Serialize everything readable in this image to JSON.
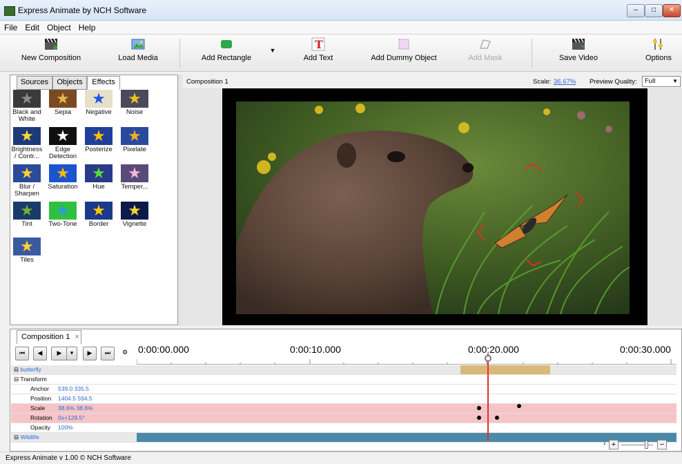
{
  "window": {
    "title": "Express Animate by NCH Software",
    "minimize": "–",
    "maximize": "□",
    "close": "✕"
  },
  "menu": [
    "File",
    "Edit",
    "Object",
    "Help"
  ],
  "toolbar": {
    "new_composition": "New Composition",
    "load_media": "Load Media",
    "add_rectangle": "Add Rectangle",
    "add_text": "Add Text",
    "add_dummy_object": "Add Dummy Object",
    "add_mask": "Add Mask",
    "save_video": "Save Video",
    "options": "Options"
  },
  "panel_tabs": [
    "Sources",
    "Objects",
    "Effects"
  ],
  "effects": [
    {
      "label": "Black and White",
      "star": "#8a8a8a",
      "bg": "#3a3a3a"
    },
    {
      "label": "Sepia",
      "star": "#e8b84a",
      "bg": "#7a4a22"
    },
    {
      "label": "Negative",
      "star": "#2056e8",
      "bg": "#e6e0c8"
    },
    {
      "label": "Noise",
      "star": "#f0c020",
      "bg": "#4a4a5a"
    },
    {
      "label": "Brightness / Contr...",
      "star": "#ffd830",
      "bg": "#1c3a7a"
    },
    {
      "label": "Edge Detection",
      "star": "#ffffff",
      "bg": "#101010"
    },
    {
      "label": "Posterize",
      "star": "#ffc000",
      "bg": "#1f3f9a"
    },
    {
      "label": "Pixelate",
      "star": "#f0b020",
      "bg": "#2a4aa0"
    },
    {
      "label": "Blur / Sharpen",
      "star": "#ffd030",
      "bg": "#2a4a9a"
    },
    {
      "label": "Saturation",
      "star": "#ffb800",
      "bg": "#1c54d0"
    },
    {
      "label": "Hue",
      "star": "#50e030",
      "bg": "#2a3a8a"
    },
    {
      "label": "Temper...",
      "star": "#f0b8e0",
      "bg": "#5a4a7a"
    },
    {
      "label": "Tint",
      "star": "#7ab030",
      "bg": "#1a3a6a"
    },
    {
      "label": "Two-Tone",
      "star": "#2a9ae0",
      "bg": "#30c040"
    },
    {
      "label": "Border",
      "star": "#ffc800",
      "bg": "#1c3a8a"
    },
    {
      "label": "Vignette",
      "star": "#ffd030",
      "bg": "#0c1a4a"
    },
    {
      "label": "Tiles",
      "star": "#ffd030",
      "bg": "#3a5aa0"
    }
  ],
  "preview": {
    "composition_label": "Composition 1",
    "scale_label": "Scale:",
    "scale_value": "36.67%",
    "quality_label": "Preview Quality:",
    "quality_value": "Full"
  },
  "timeline": {
    "tab": "Composition 1",
    "tab_close": "×",
    "times": [
      "0:00:00.000",
      "0:00:10.000",
      "0:00:20.000",
      "0:00:30.000"
    ],
    "rows": {
      "object": "butterfly",
      "transform": "Transform",
      "anchor": {
        "label": "Anchor",
        "value": "539.0  335.5"
      },
      "position": {
        "label": "Position",
        "value": "1404.5  594.5"
      },
      "scale": {
        "label": "Scale",
        "value": "38.6%  38.6%"
      },
      "rotation": {
        "label": "Rotation",
        "value": "0x+129.5°"
      },
      "opacity": {
        "label": "Opacity",
        "value": "100%"
      },
      "next_object": "Wildlife"
    }
  },
  "status": "Express Animate v 1.00 © NCH Software",
  "colors": {
    "playhead": "#e03030",
    "object_bar": "#d9b878",
    "keyframe_row": "#f6c4c6"
  }
}
